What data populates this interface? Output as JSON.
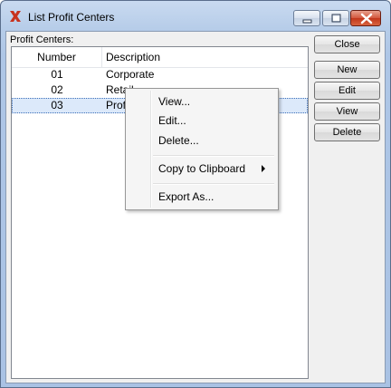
{
  "window": {
    "title": "List Profit Centers"
  },
  "list": {
    "caption": "Profit Centers:",
    "columns": [
      "Number",
      "Description"
    ],
    "rows": [
      {
        "number": "01",
        "description": "Corporate"
      },
      {
        "number": "02",
        "description": "Retail"
      },
      {
        "number": "03",
        "description": "Prof"
      }
    ],
    "selected_row": 2
  },
  "buttons": {
    "close": "Close",
    "new": "New",
    "edit": "Edit",
    "view": "View",
    "delete": "Delete"
  },
  "context_menu": {
    "items": [
      "View...",
      "Edit...",
      "Delete...",
      "Copy to Clipboard",
      "Export As..."
    ]
  },
  "icons": {
    "app": "x-logo-icon",
    "minimize": "minimize-icon",
    "maximize": "maximize-icon",
    "close": "close-icon",
    "submenu": "chevron-right-icon"
  },
  "colors": {
    "selection": "#dce9fa",
    "title_close_button": "#c2361b",
    "app_icon": "#c8321e"
  }
}
